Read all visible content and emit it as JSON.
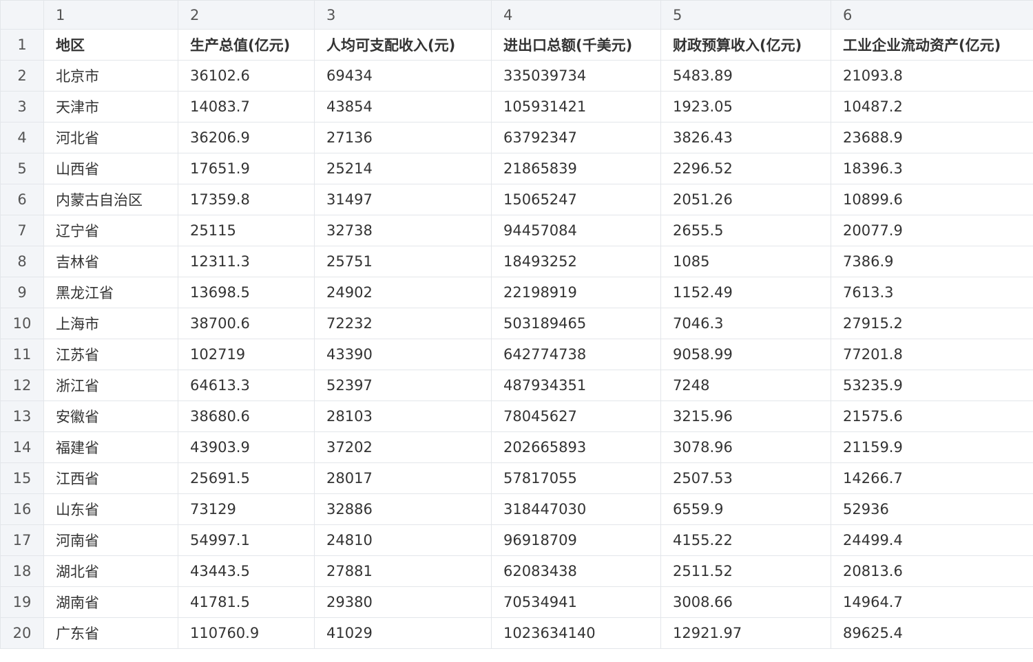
{
  "column_numbers": [
    "1",
    "2",
    "3",
    "4",
    "5",
    "6"
  ],
  "rows": [
    {
      "num": "1",
      "cells": [
        "地区",
        "生产总值(亿元)",
        "人均可支配收入(元)",
        "进出口总额(千美元)",
        "财政预算收入(亿元)",
        "工业企业流动资产(亿元)"
      ]
    },
    {
      "num": "2",
      "cells": [
        "北京市",
        "36102.6",
        "69434",
        "335039734",
        "5483.89",
        "21093.8"
      ]
    },
    {
      "num": "3",
      "cells": [
        "天津市",
        "14083.7",
        "43854",
        "105931421",
        "1923.05",
        "10487.2"
      ]
    },
    {
      "num": "4",
      "cells": [
        "河北省",
        "36206.9",
        "27136",
        "63792347",
        "3826.43",
        "23688.9"
      ]
    },
    {
      "num": "5",
      "cells": [
        "山西省",
        "17651.9",
        "25214",
        "21865839",
        "2296.52",
        "18396.3"
      ]
    },
    {
      "num": "6",
      "cells": [
        "内蒙古自治区",
        "17359.8",
        "31497",
        "15065247",
        "2051.26",
        "10899.6"
      ]
    },
    {
      "num": "7",
      "cells": [
        "辽宁省",
        "25115",
        "32738",
        "94457084",
        "2655.5",
        "20077.9"
      ]
    },
    {
      "num": "8",
      "cells": [
        "吉林省",
        "12311.3",
        "25751",
        "18493252",
        "1085",
        "7386.9"
      ]
    },
    {
      "num": "9",
      "cells": [
        "黑龙江省",
        "13698.5",
        "24902",
        "22198919",
        "1152.49",
        "7613.3"
      ]
    },
    {
      "num": "10",
      "cells": [
        "上海市",
        "38700.6",
        "72232",
        "503189465",
        "7046.3",
        "27915.2"
      ]
    },
    {
      "num": "11",
      "cells": [
        "江苏省",
        "102719",
        "43390",
        "642774738",
        "9058.99",
        "77201.8"
      ]
    },
    {
      "num": "12",
      "cells": [
        "浙江省",
        "64613.3",
        "52397",
        "487934351",
        "7248",
        "53235.9"
      ]
    },
    {
      "num": "13",
      "cells": [
        "安徽省",
        "38680.6",
        "28103",
        "78045627",
        "3215.96",
        "21575.6"
      ]
    },
    {
      "num": "14",
      "cells": [
        "福建省",
        "43903.9",
        "37202",
        "202665893",
        "3078.96",
        "21159.9"
      ]
    },
    {
      "num": "15",
      "cells": [
        "江西省",
        "25691.5",
        "28017",
        "57817055",
        "2507.53",
        "14266.7"
      ]
    },
    {
      "num": "16",
      "cells": [
        "山东省",
        "73129",
        "32886",
        "318447030",
        "6559.9",
        "52936"
      ]
    },
    {
      "num": "17",
      "cells": [
        "河南省",
        "54997.1",
        "24810",
        "96918709",
        "4155.22",
        "24499.4"
      ]
    },
    {
      "num": "18",
      "cells": [
        "湖北省",
        "43443.5",
        "27881",
        "62083438",
        "2511.52",
        "20813.6"
      ]
    },
    {
      "num": "19",
      "cells": [
        "湖南省",
        "41781.5",
        "29380",
        "70534941",
        "3008.66",
        "14964.7"
      ]
    },
    {
      "num": "20",
      "cells": [
        "广东省",
        "110760.9",
        "41029",
        "1023634140",
        "12921.97",
        "89625.4"
      ]
    }
  ]
}
